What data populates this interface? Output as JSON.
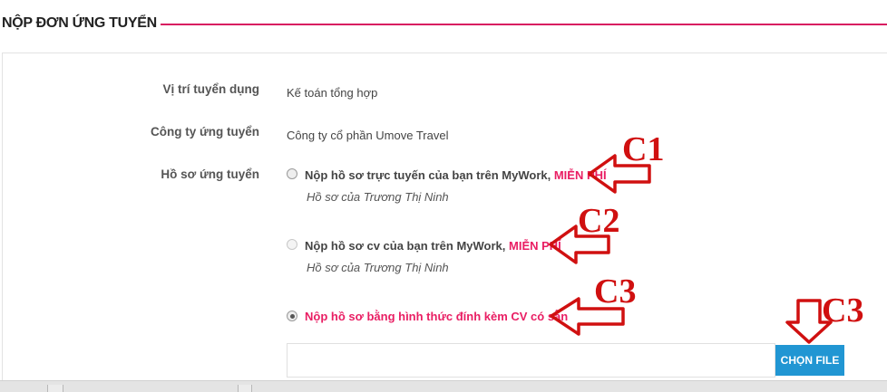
{
  "header": {
    "title": "NỘP ĐƠN ỨNG TUYỂN",
    "accent_color": "#d81b60"
  },
  "form": {
    "position": {
      "label": "Vị trí tuyển dụng",
      "value": "Kế toán tổng hợp"
    },
    "company": {
      "label": "Công ty ứng tuyển",
      "value": "Công ty cổ phần Umove Travel"
    },
    "profile_label": "Hồ sơ ứng tuyển",
    "options": [
      {
        "text": "Nộp hồ sơ trực tuyến của bạn trên MyWork, ",
        "badge": "MIỄN PHÍ",
        "sub": "Hồ sơ của Trương Thị Ninh",
        "state": "unchecked"
      },
      {
        "text": "Nộp hồ sơ cv của bạn trên MyWork, ",
        "badge": "MIỄN PHÍ",
        "sub": "Hồ sơ của Trương Thị Ninh",
        "state": "disabled"
      },
      {
        "text": "Nộp hồ sơ bằng hình thức đính kèm CV có sẵn",
        "badge": "",
        "sub": "",
        "state": "checked"
      }
    ],
    "file_button": "CHỌN FILE",
    "file_value": ""
  },
  "annotations": [
    "C1",
    "C2",
    "C3",
    "C3"
  ],
  "colors": {
    "highlight": "#e91e63",
    "button": "#2196d3",
    "annotation": "#d01010"
  }
}
